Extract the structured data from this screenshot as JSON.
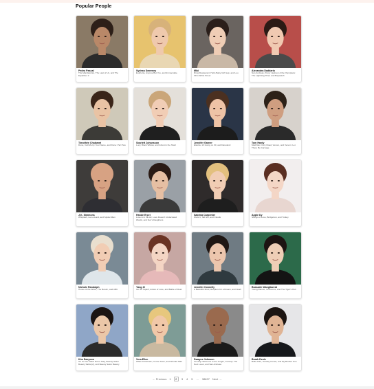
{
  "header": {
    "title": "Popular People"
  },
  "people": [
    {
      "name": "Pedro Pascal",
      "known_for": "The Mandalorian, The Last of Us, and The Equalizer 2",
      "colors": {
        "bg": "#8a7a66",
        "skin": "#b98868",
        "hair": "#2d1f18",
        "clothing": "#2b2b2b"
      }
    },
    {
      "name": "Sydney Sweeney",
      "known_for": "Euphoria, Anyone But You, and Immaculate",
      "colors": {
        "bg": "#e7c36e",
        "skin": "#efc9ad",
        "hair": "#d7b27a",
        "clothing": "#e9d7b3"
      }
    },
    {
      "name": "Miki",
      "known_for": "Drug Restaurant, Hello Baby Girl Gap, and Lou Ohio White Street",
      "colors": {
        "bg": "#6a6460",
        "skin": "#efcdb5",
        "hair": "#2a1e1a",
        "clothing": "#c9b8a6"
      }
    },
    {
      "name": "Alexandra Daddario",
      "known_for": "San Andreas, Percy Jackson & the Olympians: The Lightning Thief, and Baywatch",
      "colors": {
        "bg": "#b84e4a",
        "skin": "#f0c9b1",
        "hair": "#2b1a15",
        "clothing": "#4a4a4a"
      }
    },
    {
      "name": "Timothée Chalamet",
      "known_for": "Dune, Call Me by Your Name, and Dune: Part Two",
      "colors": {
        "bg": "#cfc9b9",
        "skin": "#e9c3a4",
        "hair": "#3a2519",
        "clothing": "#3c3b37"
      }
    },
    {
      "name": "Scarlett Johansson",
      "known_for": "Lucy, Black Widow, and Ghost in the Shell",
      "colors": {
        "bg": "#e4e0da",
        "skin": "#f1cdb5",
        "hair": "#caa679",
        "clothing": "#1f1f1f"
      }
    },
    {
      "name": "Jennifer Garner",
      "known_for": "Elektra, 13 Going on 30, and Daredevil",
      "colors": {
        "bg": "#2a3547",
        "skin": "#eec3a6",
        "hair": "#4b3020",
        "clothing": "#1c1c1c"
      }
    },
    {
      "name": "Tom Hardy",
      "known_for": "Mad Max: Fury Road, Venom, and Venom: Let There Be Carnage",
      "colors": {
        "bg": "#d7d2cc",
        "skin": "#cf9e80",
        "hair": "#2c2118",
        "clothing": "#2a2a2a"
      }
    },
    {
      "name": "J.K. Simmons",
      "known_for": "Whiplash, La La Land, and Spider-Man",
      "colors": {
        "bg": "#3e3c3a",
        "skin": "#d7a283",
        "hair": "#d7a283",
        "clothing": "#2e2e33"
      }
    },
    {
      "name": "Hande Erçel",
      "known_for": "Love is in the Air, Love Doesn't Understand Words, and Sun's Daughters",
      "colors": {
        "bg": "#9aa0a6",
        "skin": "#e6bfa3",
        "hair": "#2a1a14",
        "clothing": "#3a3a3a"
      }
    },
    {
      "name": "Sabrina Carpenter",
      "known_for": "Work It, Tall Girl, and Clouds",
      "colors": {
        "bg": "#2f2b2b",
        "skin": "#f1cdb4",
        "hair": "#e3c07e",
        "clothing": "#1e1e1e"
      }
    },
    {
      "name": "Apple Dy",
      "known_for": "Strings of Love, Bridgerton, and Turkey",
      "colors": {
        "bg": "#f2eeee",
        "skin": "#f4d6c6",
        "hair": "#5a2e22",
        "clothing": "#e8d6d0"
      }
    },
    {
      "name": "Nichole Randolph",
      "known_for": "House of the Witch, The Return, and ABC",
      "colors": {
        "bg": "#7a8a95",
        "skin": "#f1cdb4",
        "hair": "#e9dfcf",
        "clothing": "#dfe6ea"
      }
    },
    {
      "name": "Yang Zi",
      "known_for": "Go Go Squid!, Ashes of Love, and Battle of Real",
      "colors": {
        "bg": "#c6a7a3",
        "skin": "#f4d5c4",
        "hair": "#6a3323",
        "clothing": "#e6b9b9"
      }
    },
    {
      "name": "Jennifer Connelly",
      "known_for": "A Beautiful Mind, Requiem for a Dream, and Noah",
      "colors": {
        "bg": "#6f7b83",
        "skin": "#ecc6ad",
        "hair": "#1f1714",
        "clothing": "#2f3a3f"
      }
    },
    {
      "name": "Bussarin Wangtianrat",
      "known_for": "Young Dancer, Innocence, and The Tiger's Heir",
      "colors": {
        "bg": "#2c6a4a",
        "skin": "#efceb6",
        "hair": "#1d1412",
        "clothing": "#141414"
      }
    },
    {
      "name": "Kim Daeyoon",
      "known_for": "Go Go Go Fated Not to Stay, Beauty Salon Beauty Sallon(2), and Beauty Salon Beauty Service 4",
      "colors": {
        "bg": "#8fa6c7",
        "skin": "#ebc7a8",
        "hair": "#1b1412",
        "clothing": "#2b2b2b"
      }
    },
    {
      "name": "Vera-Ellen",
      "known_for": "White Christmas, On the Town, and Wonder Man",
      "colors": {
        "bg": "#7e9c96",
        "skin": "#f1c8a8",
        "hair": "#e7c77d",
        "clothing": "#c9b9a0"
      }
    },
    {
      "name": "Dwayne Johnson",
      "known_for": "Jumanji: Welcome to the Jungle, Jumanji: The Next Level, and San Andreas",
      "colors": {
        "bg": "#8a8a8a",
        "skin": "#9a6a4e",
        "hair": "#9a6a4e",
        "clothing": "#1a1a1a"
      }
    },
    {
      "name": "Burak Deniz",
      "known_for": "Bella Ciao, Sunday Conan, and My Brother Sun",
      "colors": {
        "bg": "#e6e6e8",
        "skin": "#e0b494",
        "hair": "#1c1512",
        "clothing": "#16181b"
      }
    }
  ],
  "pagination": {
    "prev_label": "← Previous",
    "pages": [
      "1",
      "2",
      "3",
      "4",
      "5",
      "...",
      "38637"
    ],
    "current": "2",
    "next_label": "Next →"
  }
}
